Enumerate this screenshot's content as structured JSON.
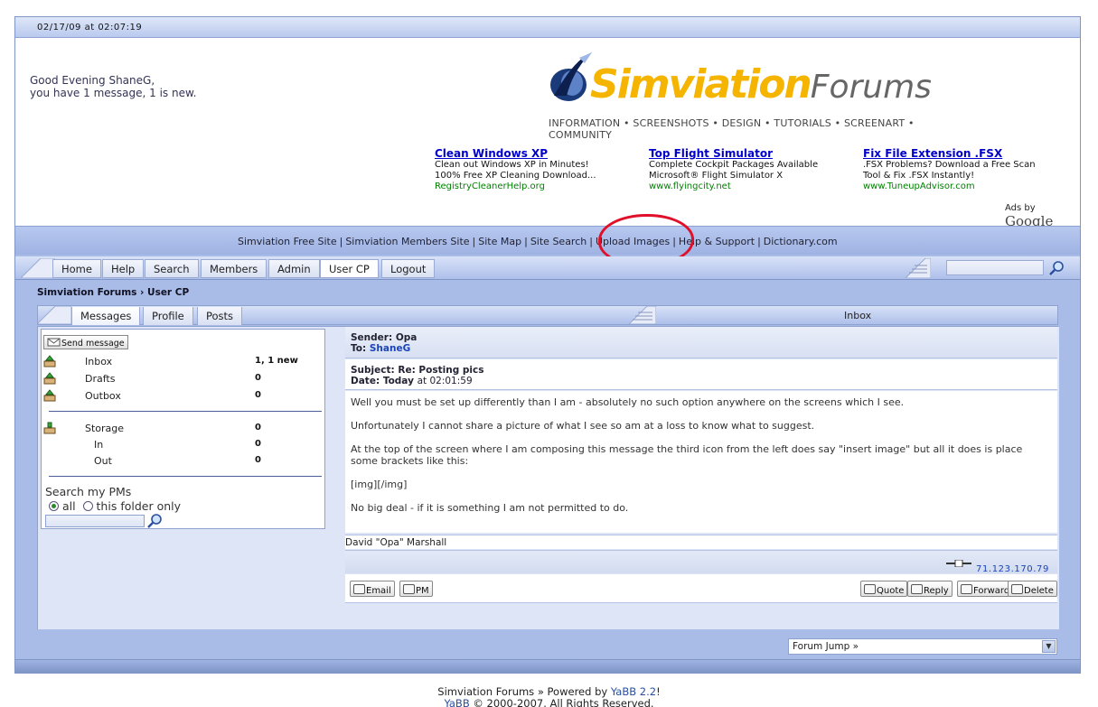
{
  "datebar": {
    "datetime": "02/17/09 at 02:07:19"
  },
  "greeting": {
    "line1": "Good Evening ShaneG,",
    "line2": "you have 1 message, 1 is new."
  },
  "logo": {
    "brand": "Simviation",
    "suffix": "Forums",
    "tagline": "INFORMATION • SCREENSHOTS • DESIGN • TUTORIALS • SCREENART • COMMUNITY"
  },
  "ads": [
    {
      "title": "Clean Windows XP",
      "line1": "Clean out Windows XP in Minutes!",
      "line2": "100% Free XP Cleaning Download...",
      "url": "RegistryCleanerHelp.org"
    },
    {
      "title": "Top Flight Simulator",
      "line1": "Complete Cockpit Packages Available",
      "line2": "Microsoft® Flight Simulator X",
      "url": "www.flyingcity.net"
    },
    {
      "title": "Fix File Extension .FSX",
      "line1": ".FSX Problems? Download a Free Scan",
      "line2": "Tool & Fix .FSX Instantly!",
      "url": "www.TuneupAdvisor.com"
    }
  ],
  "ads_by": {
    "prefix": "Ads by",
    "brand": "Google"
  },
  "linkbar": [
    "Simviation Free Site",
    "Simviation Members Site",
    "Site Map",
    "Site Search",
    "Upload Images",
    "Help & Support",
    "Dictionary.com"
  ],
  "nav": {
    "tabs": [
      "Home",
      "Help",
      "Search",
      "Members",
      "Admin",
      "User CP",
      "Logout"
    ],
    "active": "User CP"
  },
  "breadcrumb": "Simviation Forums › User CP",
  "subnav": {
    "tabs": [
      "Messages",
      "Profile",
      "Posts"
    ],
    "active": "Messages",
    "folder_title": "Inbox"
  },
  "left": {
    "send_button": "Send message",
    "folders": [
      {
        "name": "Inbox",
        "count": "1, 1 new"
      },
      {
        "name": "Drafts",
        "count": "0"
      },
      {
        "name": "Outbox",
        "count": "0"
      }
    ],
    "storage": {
      "name": "Storage",
      "count": "0",
      "in_label": "In",
      "in_count": "0",
      "out_label": "Out",
      "out_count": "0"
    },
    "search_title": "Search my PMs",
    "radio_all": "all",
    "radio_folder": "this folder only"
  },
  "message": {
    "sender_label": "Sender:",
    "sender": "Opa",
    "to_label": "To:",
    "to": "ShaneG",
    "subject_label": "Subject:",
    "subject": "Re: Posting pics",
    "date_label": "Date:",
    "date_day": "Today",
    "date_time": "at 02:01:59",
    "body": [
      "Well you must be set up differently than I am - absolutely no such option anywhere on the screens which I see.",
      "Unfortunately I cannot share a picture of what I see so am at a loss to know what to suggest.",
      "At the top of the screen where I am composing this message the third icon from the left does say \"insert image\" but all it does is place some brackets like this:",
      "[img][/img]",
      "No big deal - if it is something I am not permitted to do."
    ],
    "signature": "David \"Opa\" Marshall",
    "ip": "71.123.170.79",
    "actions_left": [
      "Email",
      "PM"
    ],
    "actions_right": [
      "Quote",
      "Reply",
      "Forward",
      "Delete"
    ]
  },
  "forum_jump": "Forum Jump »",
  "footer": {
    "line1_a": "Simviation Forums » Powered by ",
    "line1_b": "YaBB 2.2",
    "line1_c": "!",
    "line2_a": "YaBB",
    "line2_b": " © 2000-2007. All Rights Reserved."
  }
}
